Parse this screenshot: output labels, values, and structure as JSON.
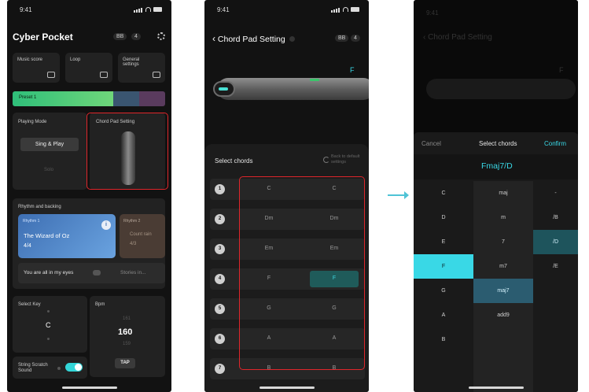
{
  "status": {
    "time": "9:41"
  },
  "screen1": {
    "app_title": "Cyber Pocket",
    "header_badges": [
      "BB",
      "4"
    ],
    "tiles": [
      "Music score",
      "Loop",
      "General settings"
    ],
    "preset_label": "Preset 1",
    "playing_mode_label": "Playing Mode",
    "playing_mode_button": "Sing & Play",
    "playing_mode_secondary": "Solo",
    "chord_pad_setting_label": "Chord Pad Setting",
    "rhythm_label": "Rhythm and backing",
    "rhythm_card1": {
      "tag": "Rhythm 1",
      "title": "The Wizard of Oz",
      "meter": "4/4"
    },
    "rhythm_card2": {
      "tag": "Rhythm 2",
      "title": "Count rain",
      "meter": "4/3"
    },
    "song_line": "You are all in my eyes",
    "song_line_right": "Stories in...",
    "select_key_label": "Select Key",
    "key_value": "C",
    "bpm_label": "Bpm",
    "bpm_prev": "161",
    "bpm_value": "160",
    "bpm_next": "159",
    "string_scratch_label": "String Scratch Sound",
    "tap_label": "TAP"
  },
  "screen2": {
    "nav_title": "Chord Pad Setting",
    "header_badges": [
      "BB",
      "4"
    ],
    "current_chord": "F",
    "select_chords_label": "Select chords",
    "back_default_label": "Back to default settings",
    "rows": [
      {
        "num": "1",
        "a": "C",
        "b": "C"
      },
      {
        "num": "2",
        "a": "Dm",
        "b": "Dm"
      },
      {
        "num": "3",
        "a": "Em",
        "b": "Em"
      },
      {
        "num": "4",
        "a": "F",
        "b": "F"
      },
      {
        "num": "5",
        "a": "G",
        "b": "G"
      },
      {
        "num": "6",
        "a": "A",
        "b": "A"
      },
      {
        "num": "7",
        "a": "B",
        "b": "B"
      }
    ]
  },
  "screen3": {
    "cancel_label": "Cancel",
    "select_chords_label": "Select chords",
    "confirm_label": "Confirm",
    "chord_display": "Fmaj7/D",
    "roots": [
      "C",
      "D",
      "E",
      "F",
      "G",
      "A",
      "B"
    ],
    "qualities": [
      "maj",
      "m",
      "7",
      "m7",
      "maj7",
      "add9"
    ],
    "bass": [
      "-",
      "/B",
      "/D",
      "/E"
    ]
  },
  "colors": {
    "accent": "#39d8e6",
    "highlight_red": "#e0262b",
    "preset_green": "#2fbf7a"
  }
}
